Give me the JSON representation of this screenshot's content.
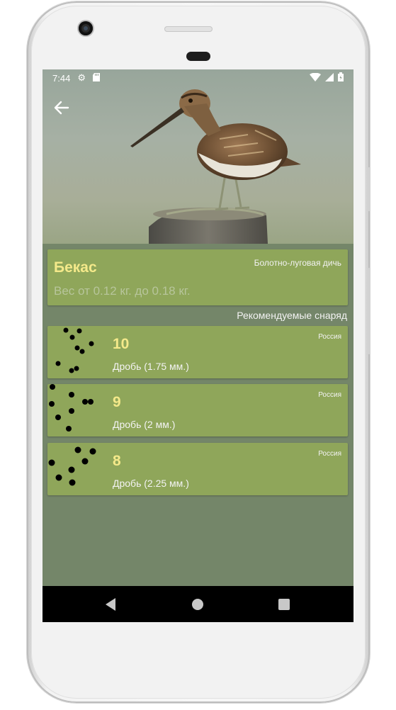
{
  "status_bar": {
    "time": "7:44",
    "icons": [
      "settings-icon",
      "sd-card-icon",
      "wifi-icon",
      "signal-icon",
      "battery-icon"
    ]
  },
  "toolbar": {
    "back_icon": "arrow-left-icon"
  },
  "hero": {
    "image": "common-snipe-bird-photo"
  },
  "game_info": {
    "name": "Бекас",
    "category": "Болотно-луговая дичь",
    "weight": "Вес от 0.12 кг. до 0.18 кг."
  },
  "recommended_label": "Рекомендуемые снаряд",
  "shot_items": [
    {
      "number": "10",
      "description": "Дробь (1.75 мм.)",
      "origin": "Россия"
    },
    {
      "number": "9",
      "description": "Дробь (2 мм.)",
      "origin": "Россия"
    },
    {
      "number": "8",
      "description": "Дробь (2.25 мм.)",
      "origin": "Россия"
    }
  ],
  "nav_bar": {
    "buttons": [
      "back-triangle-icon",
      "home-circle-icon",
      "recents-square-icon"
    ]
  },
  "colors": {
    "screen_background": "#748669",
    "card": "#8fa65a",
    "title_accent": "#f4e98a",
    "weight_text": "#b7c59b"
  }
}
